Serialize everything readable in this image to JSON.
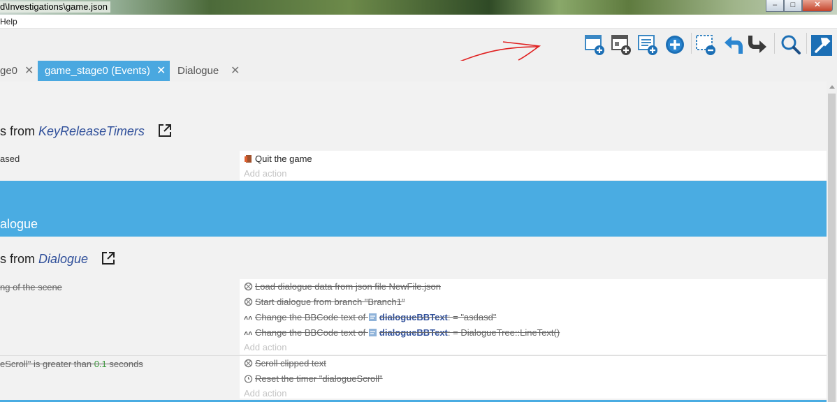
{
  "window": {
    "title": "d\\Investigations\\game.json",
    "minimize": "–",
    "maximize": "□",
    "close": "✕"
  },
  "menu": {
    "help": "Help"
  },
  "toolbar": {
    "icons": [
      "add-event-icon",
      "add-subevent-icon",
      "add-comment-icon",
      "add-other-icon",
      "delete-event-icon",
      "undo-icon",
      "redo-icon",
      "search-icon",
      "settings-icon"
    ],
    "accent": "#3b88c4"
  },
  "tabs": [
    {
      "label": "ge0",
      "close": "✕"
    },
    {
      "label": "game_stage0 (Events)",
      "close": "✕",
      "active": true
    },
    {
      "label": "Dialogue",
      "close": "✕"
    }
  ],
  "events": {
    "link1": {
      "prefix": "s from ",
      "name": "KeyReleaseTimers"
    },
    "e1": {
      "condition": "ased",
      "actions": [
        {
          "text": "Quit the game",
          "icon": "exit-door-icon"
        }
      ],
      "add_action": "Add action"
    },
    "group": {
      "label": "alogue",
      "color": "#4aace2"
    },
    "link2": {
      "prefix": "s from ",
      "name": "Dialogue"
    },
    "e2": {
      "condition": "ng of the scene",
      "actions": [
        {
          "text": "Load dialogue data from json file NewFile.json"
        },
        {
          "text": "Start dialogue from branch \"Branch1\""
        },
        {
          "pre": "Change the BBCode text of ",
          "obj": "dialogueBBText",
          "post": ": = \"asdasd\""
        },
        {
          "pre": "Change the BBCode text of ",
          "obj": "dialogueBBText",
          "post": ": = DialogueTree::LineText()"
        }
      ],
      "add_action": "Add action"
    },
    "e3": {
      "condition_pre": "eScroll\" is greater than ",
      "condition_num": "0.1",
      "condition_post": " seconds",
      "actions": [
        {
          "text": "Scroll clipped text"
        },
        {
          "text": "Reset the timer \"dialogueScroll\""
        }
      ],
      "add_action": "Add action"
    }
  }
}
